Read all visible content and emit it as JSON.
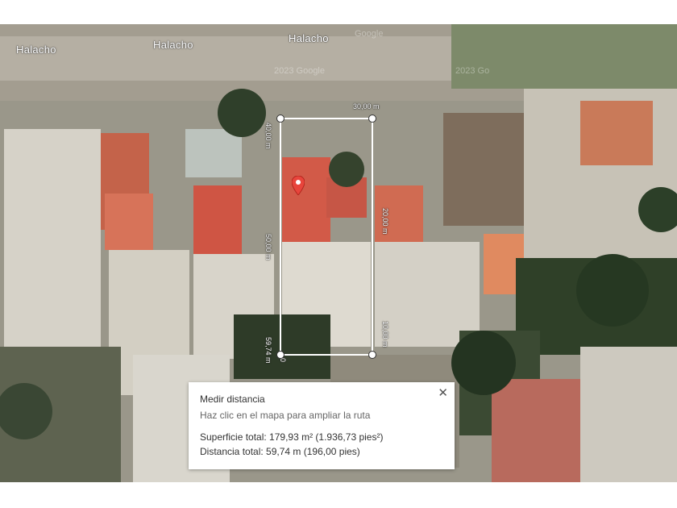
{
  "map": {
    "streets": [
      "Halacho",
      "Halacho",
      "Halacho"
    ],
    "watermarks": [
      "Google",
      "2023 Google",
      "2023 Go"
    ],
    "measure_labels": {
      "top": "30,00 m",
      "left_upper": "40,00 m",
      "left_middle": "50,00 m",
      "left_lower": "59,74 m",
      "right_upper": "20,00 m",
      "right_lower": "10,00 m",
      "origin": "0"
    },
    "pin_icon": "location-pin-icon",
    "colors": {
      "pin": "#e8453c",
      "measure_line": "#ffffff"
    }
  },
  "panel": {
    "title": "Medir distancia",
    "hint": "Haz clic en el mapa para ampliar la ruta",
    "area_label": "Superficie total: 179,93 m² (1.936,73 pies²)",
    "distance_label": "Distancia total: 59,74 m (196,00 pies)",
    "close_icon": "close-icon",
    "close_glyph": "✕"
  }
}
